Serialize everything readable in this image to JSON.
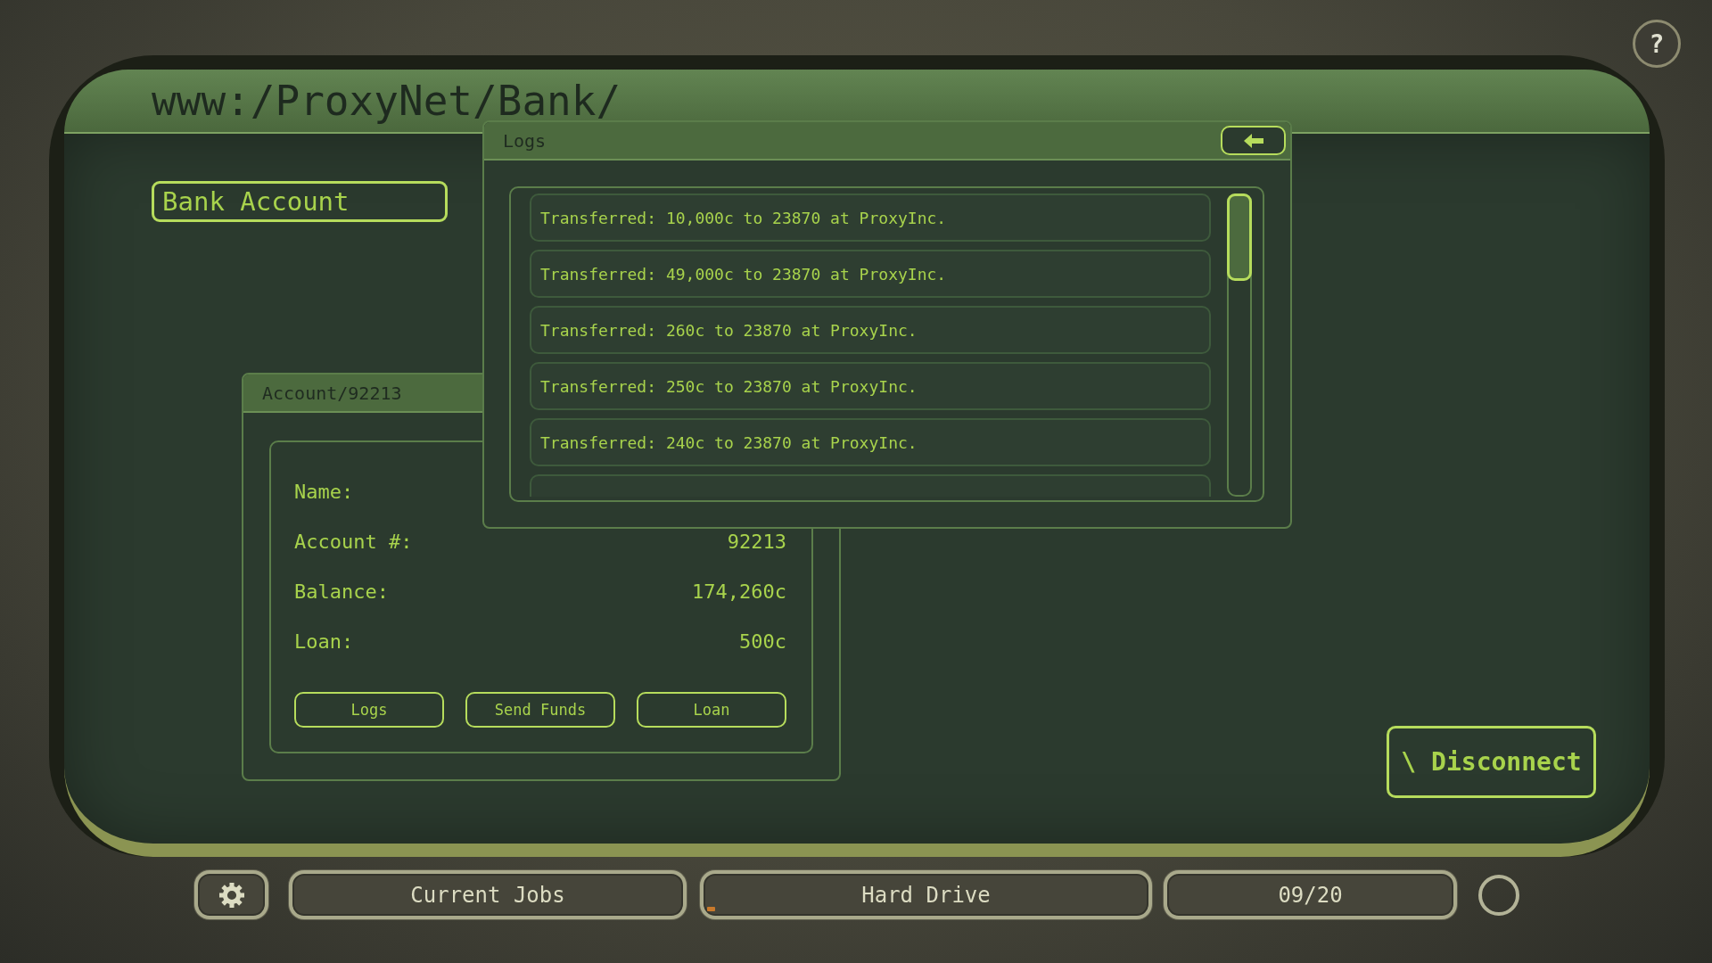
{
  "address": "www:/ProxyNet/Bank/",
  "nav_button": "Bank Account",
  "account_window": {
    "title": "Account/92213",
    "fields": [
      {
        "label": "Name:"
      },
      {
        "label": "Account #:",
        "value": "92213"
      },
      {
        "label": "Balance:",
        "value": "174,260c"
      },
      {
        "label": "Loan:",
        "value": "500c"
      }
    ],
    "buttons": [
      "Logs",
      "Send Funds",
      "Loan"
    ]
  },
  "logs_window": {
    "title": "Logs",
    "entries": [
      "Transferred: 10,000c to 23870 at ProxyInc.",
      "Transferred: 49,000c to 23870 at ProxyInc.",
      "Transferred: 260c to 23870 at ProxyInc.",
      "Transferred: 250c to 23870 at ProxyInc.",
      "Transferred: 240c to 23870 at ProxyInc."
    ]
  },
  "disconnect_button": "\\ Disconnect",
  "help_button": "?",
  "taskbar": [
    {
      "kind": "settings"
    },
    {
      "kind": "text",
      "label": "Current Jobs",
      "indicator": false
    },
    {
      "kind": "text",
      "label": "Hard Drive",
      "indicator": true
    },
    {
      "kind": "text",
      "label": "09/20",
      "indicator": false
    },
    {
      "kind": "ring"
    }
  ]
}
